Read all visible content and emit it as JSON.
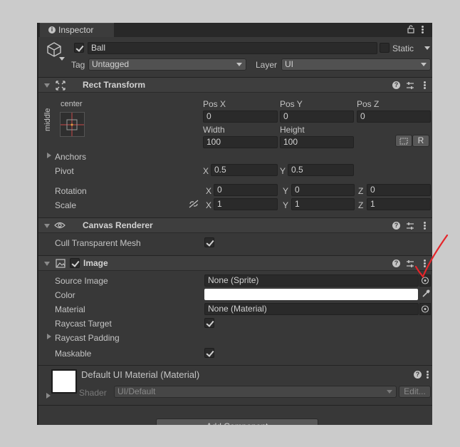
{
  "tab": {
    "label": "Inspector"
  },
  "object": {
    "name": "Ball",
    "static_label": "Static",
    "tag_label": "Tag",
    "tag_value": "Untagged",
    "layer_label": "Layer",
    "layer_value": "UI"
  },
  "rect_transform": {
    "title": "Rect Transform",
    "anchor_top": "center",
    "anchor_side": "middle",
    "pos_x_label": "Pos X",
    "pos_y_label": "Pos Y",
    "pos_z_label": "Pos Z",
    "pos_x": "0",
    "pos_y": "0",
    "pos_z": "0",
    "width_label": "Width",
    "height_label": "Height",
    "width": "100",
    "height": "100",
    "r_label": "R",
    "anchors_label": "Anchors",
    "pivot_label": "Pivot",
    "pivot_x": "0.5",
    "pivot_y": "0.5",
    "rotation_label": "Rotation",
    "rot_x": "0",
    "rot_y": "0",
    "rot_z": "0",
    "scale_label": "Scale",
    "scale_x": "1",
    "scale_y": "1",
    "scale_z": "1",
    "x": "X",
    "y": "Y",
    "z": "Z"
  },
  "canvas_renderer": {
    "title": "Canvas Renderer",
    "cull_label": "Cull Transparent Mesh"
  },
  "image": {
    "title": "Image",
    "source_label": "Source Image",
    "source_value": "None (Sprite)",
    "color_label": "Color",
    "color_value": "#ffffff",
    "material_label": "Material",
    "material_value": "None (Material)",
    "raycast_target_label": "Raycast Target",
    "raycast_padding_label": "Raycast Padding",
    "maskable_label": "Maskable"
  },
  "material": {
    "title": "Default UI Material (Material)",
    "shader_label": "Shader",
    "shader_value": "UI/Default",
    "edit_label": "Edit..."
  },
  "footer": {
    "add_component_label": "Add Component"
  },
  "colors": {
    "panel_bg": "#383838",
    "annotation": "#e5252a"
  }
}
